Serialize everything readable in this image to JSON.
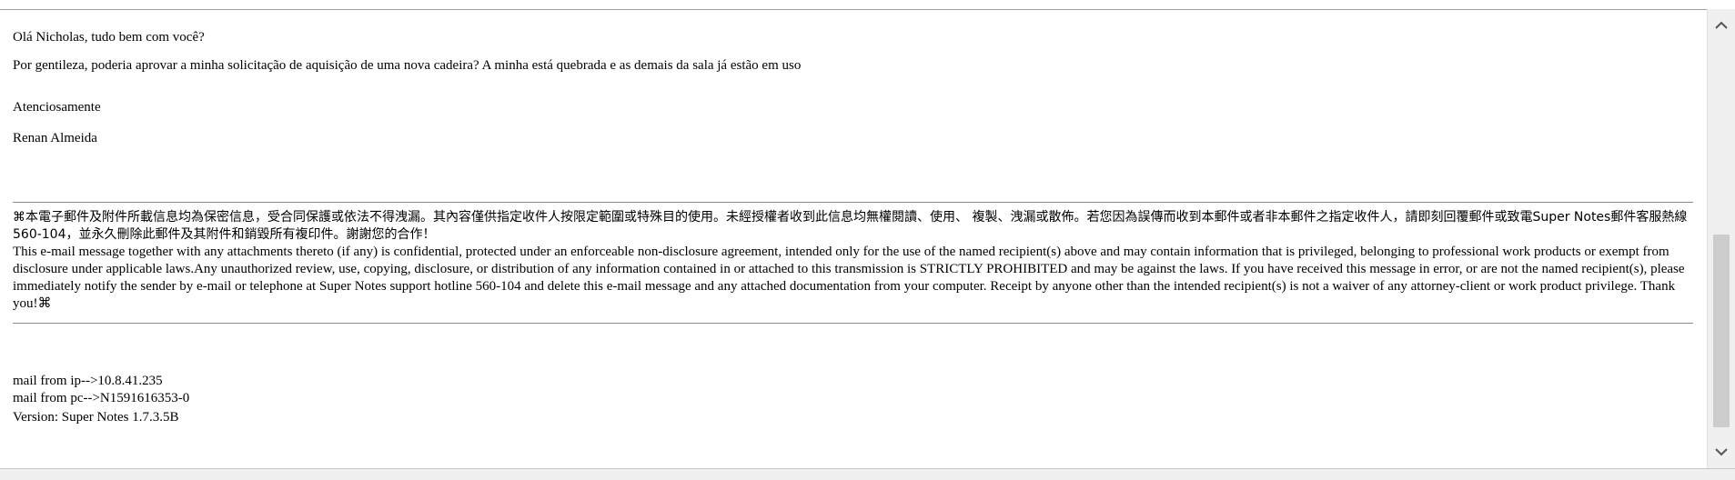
{
  "email": {
    "greeting": "Olá Nicholas, tudo bem com você?",
    "request": "Por gentileza, poderia aprovar a minha solicitação de aquisição de uma nova cadeira? A minha está quebrada e as demais da sala já estão em uso",
    "closing": "Atenciosamente",
    "signature": "Renan Almeida"
  },
  "disclaimer": {
    "chinese": "⌘本電子郵件及附件所載信息均為保密信息，受合同保護或依法不得洩漏。其內容僅供指定收件人按限定範圍或特殊目的使用。未經授權者收到此信息均無權閱讀、使用、 複製、洩漏或散佈。若您因為誤傳而收到本郵件或者非本郵件之指定收件人，請即刻回覆郵件或致電Super Notes郵件客服熱線 560-104，並永久刪除此郵件及其附件和銷毀所有複印件。謝謝您的合作！",
    "english": "This e-mail message together with any attachments thereto (if any) is confidential, protected under an enforceable non-disclosure agreement, intended only for the use of the named recipient(s) above and may contain information that is privileged, belonging to professional work products or exempt from disclosure under applicable laws.Any unauthorized review, use, copying, disclosure, or distribution of any information contained in or attached to this transmission is STRICTLY PROHIBITED and may be against the laws. If you have received this message in error, or are not the named recipient(s), please immediately notify the sender by e-mail or telephone at Super Notes support hotline 560-104 and delete this e-mail message and any attached documentation from your computer. Receipt by anyone other than the intended recipient(s) is not a waiver of any attorney-client or work product privilege. Thank you!⌘"
  },
  "meta": {
    "ip_line": "mail from ip-->10.8.41.235",
    "pc_line": "mail from pc-->N1591616353-0",
    "version_line": "Version: Super Notes 1.7.3.5B"
  },
  "scrollbar": {
    "up_icon": "chevron-up-icon",
    "down_icon": "chevron-down-icon"
  }
}
